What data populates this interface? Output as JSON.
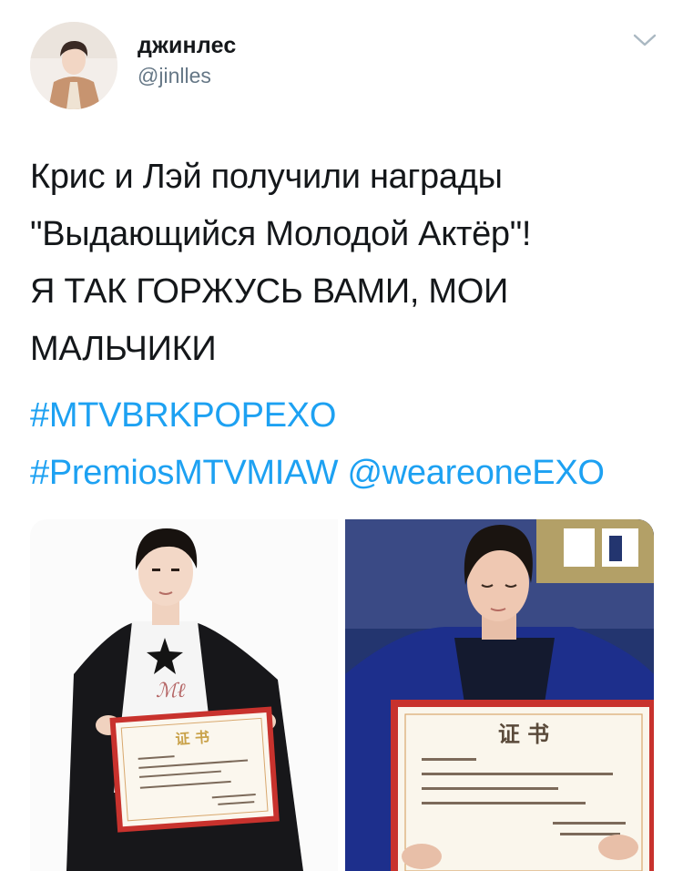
{
  "user": {
    "display_name": "джинлес",
    "handle": "@jinlles"
  },
  "tweet": {
    "lines": [
      "Крис и Лэй получили награды",
      "\"Выдающийся Молодой Актёр\"!",
      "Я ТАК ГОРЖУСЬ ВАМИ, МОИ",
      "МАЛЬЧИКИ"
    ],
    "hashtag_1": "#MTVBRKPOPEXO",
    "hashtag_2": "#PremiosMTVMIAW",
    "mention": "@weareoneEXO"
  },
  "icons": {
    "menu": "chevron-down-icon"
  },
  "colors": {
    "link": "#1da1f2",
    "text": "#14171a",
    "secondary": "#657786",
    "certificate_red": "#c8322d"
  }
}
